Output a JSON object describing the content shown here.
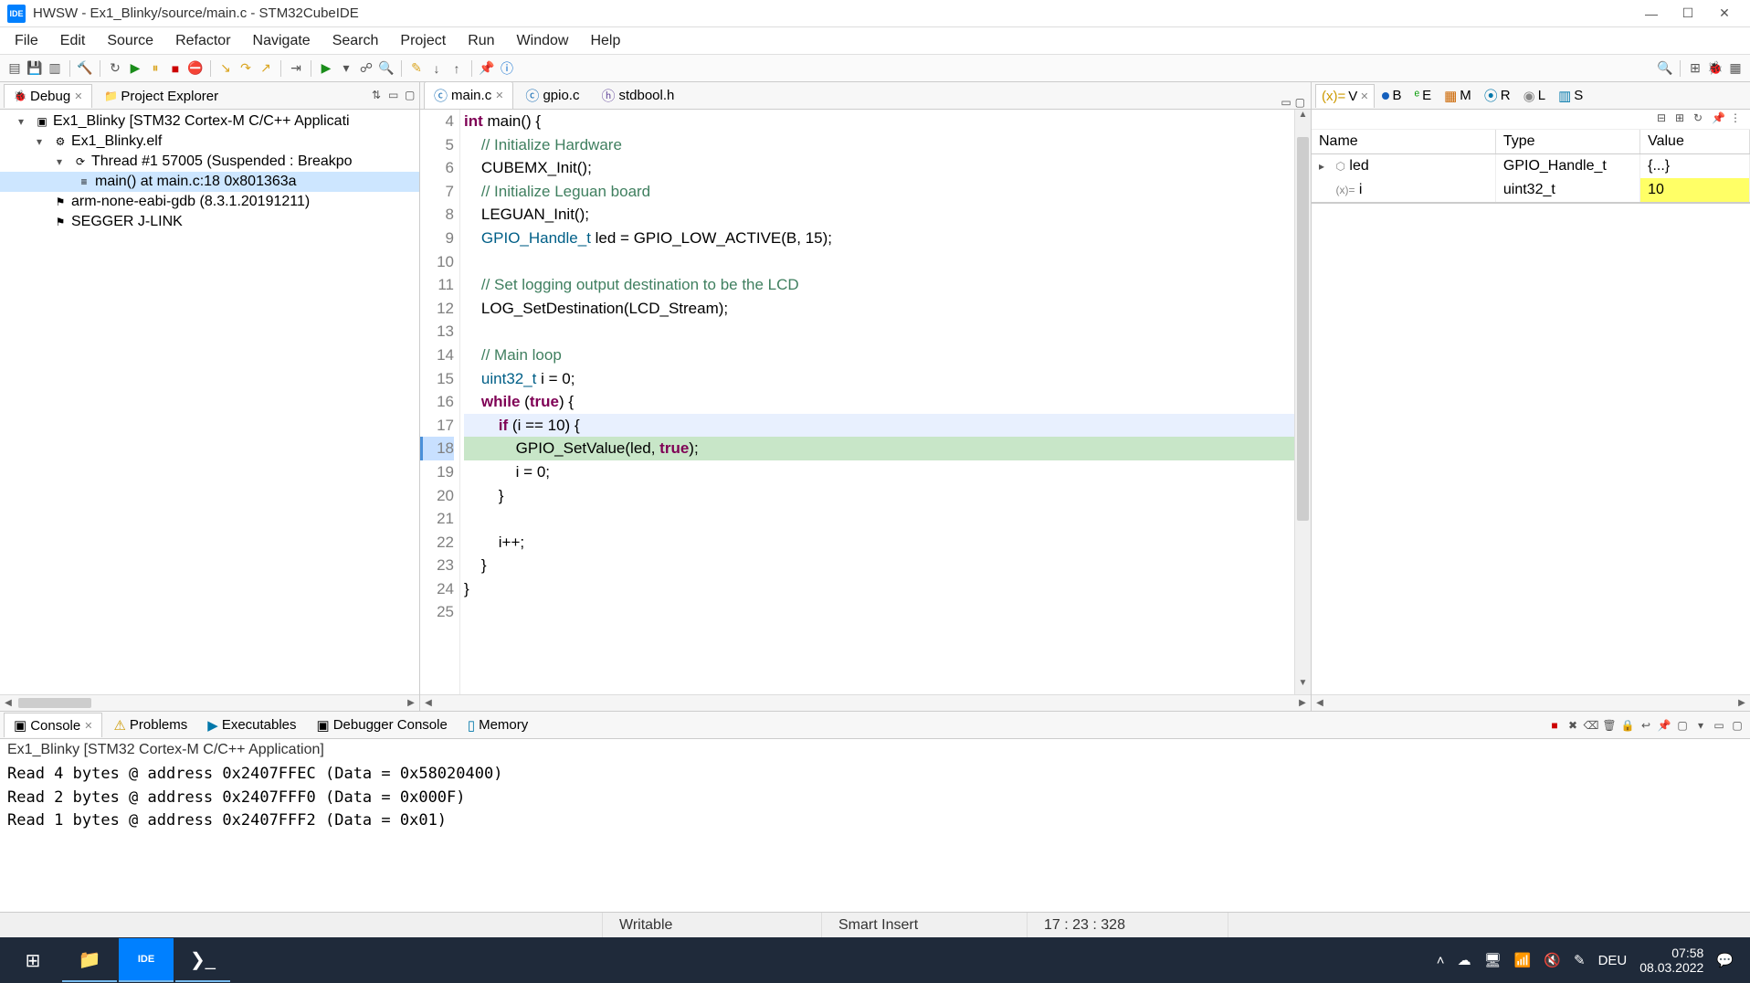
{
  "title": "HWSW - Ex1_Blinky/source/main.c - STM32CubeIDE",
  "app_icon_text": "IDE",
  "menu": [
    "File",
    "Edit",
    "Source",
    "Refactor",
    "Navigate",
    "Search",
    "Project",
    "Run",
    "Window",
    "Help"
  ],
  "left_tabs": {
    "debug": "Debug",
    "project_explorer": "Project Explorer"
  },
  "tree": {
    "app": "Ex1_Blinky [STM32 Cortex-M C/C++ Applicati",
    "elf": "Ex1_Blinky.elf",
    "thread": "Thread #1 57005 (Suspended : Breakpo",
    "frame": "main() at main.c:18 0x801363a",
    "gdb": "arm-none-eabi-gdb (8.3.1.20191211)",
    "jlink": "SEGGER J-LINK"
  },
  "editor_tabs": {
    "main": "main.c",
    "gpio": "gpio.c",
    "stdbool": "stdbool.h"
  },
  "code": {
    "lines": [
      {
        "n": 4,
        "txt": "int main() {",
        "kind": "sig"
      },
      {
        "n": 5,
        "txt": "    // Initialize Hardware",
        "kind": "cm"
      },
      {
        "n": 6,
        "txt": "    CUBEMX_Init();",
        "kind": "st"
      },
      {
        "n": 7,
        "txt": "    // Initialize Leguan board",
        "kind": "cm"
      },
      {
        "n": 8,
        "txt": "    LEGUAN_Init();",
        "kind": "st"
      },
      {
        "n": 9,
        "txt": "    GPIO_Handle_t led = GPIO_LOW_ACTIVE(B, 15);",
        "kind": "st"
      },
      {
        "n": 10,
        "txt": "",
        "kind": "st"
      },
      {
        "n": 11,
        "txt": "    // Set logging output destination to be the LCD",
        "kind": "cm"
      },
      {
        "n": 12,
        "txt": "    LOG_SetDestination(LCD_Stream);",
        "kind": "st"
      },
      {
        "n": 13,
        "txt": "",
        "kind": "st"
      },
      {
        "n": 14,
        "txt": "    // Main loop",
        "kind": "cm"
      },
      {
        "n": 15,
        "txt": "    uint32_t i = 0;",
        "kind": "st"
      },
      {
        "n": 16,
        "txt": "    while (true) {",
        "kind": "kw"
      },
      {
        "n": 17,
        "txt": "        if (i == 10) {",
        "kind": "kw",
        "current": true
      },
      {
        "n": 18,
        "txt": "            GPIO_SetValue(led, true);",
        "kind": "exec",
        "bp": true
      },
      {
        "n": 19,
        "txt": "            i = 0;",
        "kind": "st"
      },
      {
        "n": 20,
        "txt": "        }",
        "kind": "st"
      },
      {
        "n": 21,
        "txt": "",
        "kind": "st"
      },
      {
        "n": 22,
        "txt": "        i++;",
        "kind": "st"
      },
      {
        "n": 23,
        "txt": "    }",
        "kind": "st"
      },
      {
        "n": 24,
        "txt": "}",
        "kind": "st"
      },
      {
        "n": 25,
        "txt": "",
        "kind": "st"
      }
    ]
  },
  "right_tabs": {
    "v": "V",
    "b": "B",
    "e": "E",
    "m": "M",
    "r": "R",
    "l": "L",
    "s": "S"
  },
  "vars_headers": {
    "name": "Name",
    "type": "Type",
    "value": "Value"
  },
  "vars": [
    {
      "name": "led",
      "type": "GPIO_Handle_t",
      "value": "{...}",
      "expandable": true,
      "icon": "⬡"
    },
    {
      "name": "i",
      "type": "uint32_t",
      "value": "10",
      "highlight": true,
      "icon": "(x)="
    }
  ],
  "bottom_tabs": {
    "console": "Console",
    "problems": "Problems",
    "executables": "Executables",
    "debugger": "Debugger Console",
    "memory": "Memory"
  },
  "console_title": "Ex1_Blinky [STM32 Cortex-M C/C++ Application]",
  "console_lines": [
    "Read 4 bytes @ address 0x2407FFEC (Data = 0x58020400)",
    "Read 2 bytes @ address 0x2407FFF0 (Data = 0x000F)",
    "Read 1 bytes @ address 0x2407FFF2 (Data = 0x01)"
  ],
  "status": {
    "writable": "Writable",
    "mode": "Smart Insert",
    "pos": "17 : 23 : 328"
  },
  "taskbar": {
    "lang": "DEU",
    "time": "07:58",
    "date": "08.03.2022"
  }
}
